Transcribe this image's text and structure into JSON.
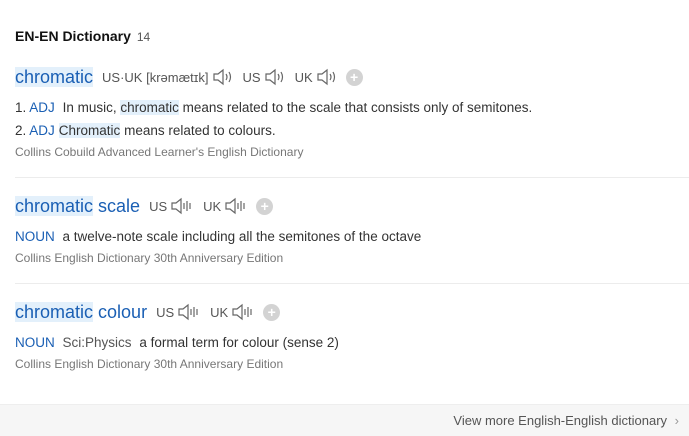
{
  "header": {
    "title": "EN-EN Dictionary",
    "count": "14"
  },
  "entries": [
    {
      "word_hl": "chromatic",
      "word_rest": "",
      "phonetics": [
        {
          "label": "US·UK [krəmætɪk]"
        },
        {
          "label": "US"
        },
        {
          "label": "UK"
        }
      ],
      "definitions": [
        {
          "num": "1.",
          "pos": "ADJ",
          "pre": "In music,",
          "hl": "chromatic",
          "post": "means related to the scale that consists only of semitones."
        },
        {
          "num": "2.",
          "pos": "ADJ",
          "pre": "",
          "hl": "Chromatic",
          "post": "means related to colours."
        }
      ],
      "source": "Collins Cobuild Advanced Learner's English Dictionary"
    },
    {
      "word_hl": "chromatic",
      "word_rest": " scale",
      "phonetics": [
        {
          "label": "US"
        },
        {
          "label": "UK"
        }
      ],
      "definitions": [
        {
          "pos": "NOUN",
          "text": "a twelve-note scale including all the semitones of the octave"
        }
      ],
      "source": "Collins English Dictionary 30th Anniversary Edition"
    },
    {
      "word_hl": "chromatic",
      "word_rest": " colour",
      "phonetics": [
        {
          "label": "US"
        },
        {
          "label": "UK"
        }
      ],
      "definitions": [
        {
          "pos": "NOUN",
          "field": "Sci:Physics",
          "text": "a formal term for colour (sense 2)"
        }
      ],
      "source": "Collins English Dictionary 30th Anniversary Edition"
    }
  ],
  "footer": {
    "more_label": "View more English-English dictionary",
    "chevron": "›"
  },
  "icons": {
    "speaker": "speaker-icon",
    "add": "plus-icon"
  },
  "colors": {
    "link": "#1a5fb4",
    "highlight": "#e3f0fb"
  }
}
